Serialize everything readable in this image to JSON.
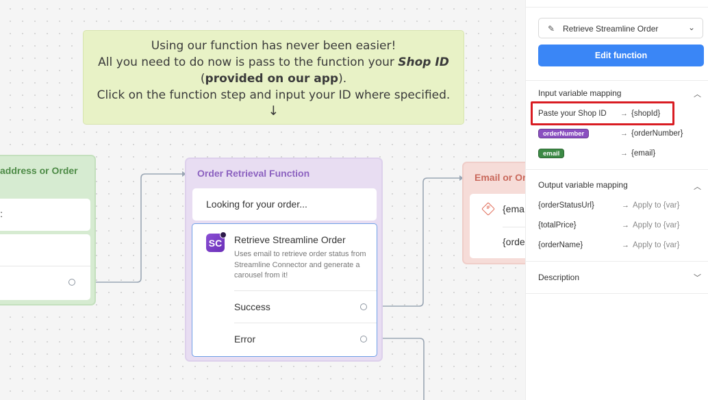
{
  "colors": {
    "accent": "#3a86f6",
    "highlight": "#d91c22",
    "order_number_pill": "#8a4fc0",
    "email_pill": "#3c8a45"
  },
  "note": {
    "line1": "Using our function has never been easier!",
    "line2_pre": "All you need to do now is pass to the function your ",
    "line2_em": "Shop ID",
    "line3_open": "(",
    "line3_bold": "provided on our app",
    "line3_close": ").",
    "line4": "Click on the function step and input your ID where specified.",
    "arrow": "↓"
  },
  "left_block": {
    "title": "address or Order",
    "card_text": "w:"
  },
  "mid_block": {
    "title": "Order Retrieval Function",
    "message": "Looking for your order...",
    "function": {
      "logo": "SC",
      "name": "Retrieve Streamline Order",
      "description": "Uses email to retrieve order status from Streamline Connector and generate a carousel from it!",
      "success_label": "Success",
      "error_label": "Error"
    }
  },
  "right_block": {
    "title": "Email or Orde",
    "row1": "{ema",
    "row2": "{orde",
    "icon": "if-icon"
  },
  "panel": {
    "select_value": "Retrieve Streamline Order",
    "edit_button": "Edit function",
    "input_section": {
      "title": "Input variable mapping",
      "rows": [
        {
          "source": "Paste your Shop ID",
          "arrow": "→",
          "target": "{shopId}"
        },
        {
          "source": "orderNumber",
          "arrow": "→",
          "target": "{orderNumber}"
        },
        {
          "source": "email",
          "arrow": "→",
          "target": "{email}"
        }
      ]
    },
    "output_section": {
      "title": "Output variable mapping",
      "rows": [
        {
          "source": "{orderStatusUrl}",
          "arrow": "→",
          "target": "Apply to {var}"
        },
        {
          "source": "{totalPrice}",
          "arrow": "→",
          "target": "Apply to {var}"
        },
        {
          "source": "{orderName}",
          "arrow": "→",
          "target": "Apply to {var}"
        }
      ]
    },
    "description_section": {
      "title": "Description"
    }
  }
}
